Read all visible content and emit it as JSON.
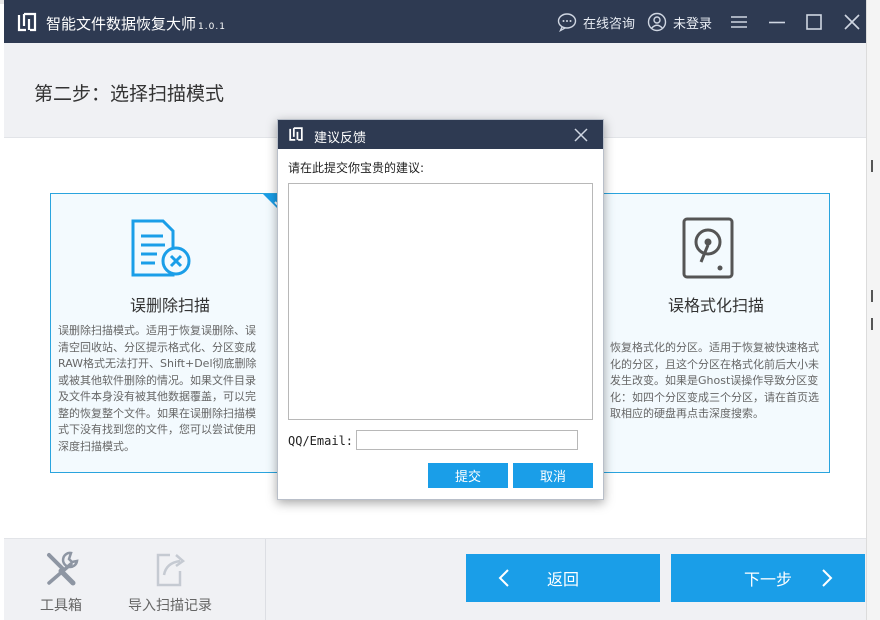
{
  "app": {
    "title": "智能文件数据恢复大师",
    "version": "1.0.1"
  },
  "titlebar": {
    "consult_label": "在线咨询",
    "login_label": "未登录"
  },
  "step": {
    "title": "第二步：选择扫描模式"
  },
  "cards": [
    {
      "title": "误删除扫描",
      "description": "误删除扫描模式。适用于恢复误删除、误清空回收站、分区提示格式化、分区变成RAW格式无法打开、Shift+Del彻底删除或被其他软件删除的情况。如果文件目录及文件本身没有被其他数据覆盖，可以完整的恢复整个文件。如果在误删除扫描模式下没有找到您的文件，您可以尝试使用深度扫描模式。",
      "selected": true
    },
    {
      "title": "误格式化扫描",
      "description": "恢复格式化的分区。适用于恢复被快速格式化的分区，且这个分区在格式化前后大小未发生改变。如果是Ghost误操作导致分区变化：如四个分区变成三个分区，请在首页选取相应的硬盘再点击深度搜索。",
      "selected": false
    }
  ],
  "bottom": {
    "toolbox_label": "工具箱",
    "import_label": "导入扫描记录",
    "back_label": "返回",
    "next_label": "下一步"
  },
  "dialog": {
    "title": "建议反馈",
    "prompt": "请在此提交你宝贵的建议:",
    "feedback_value": "",
    "qq_label": "QQ/Email:",
    "qq_value": "",
    "submit_label": "提交",
    "cancel_label": "取消"
  },
  "colors": {
    "titlebar": "#2e3a52",
    "accent": "#1a9ee8",
    "card_border": "#2aa4de"
  }
}
